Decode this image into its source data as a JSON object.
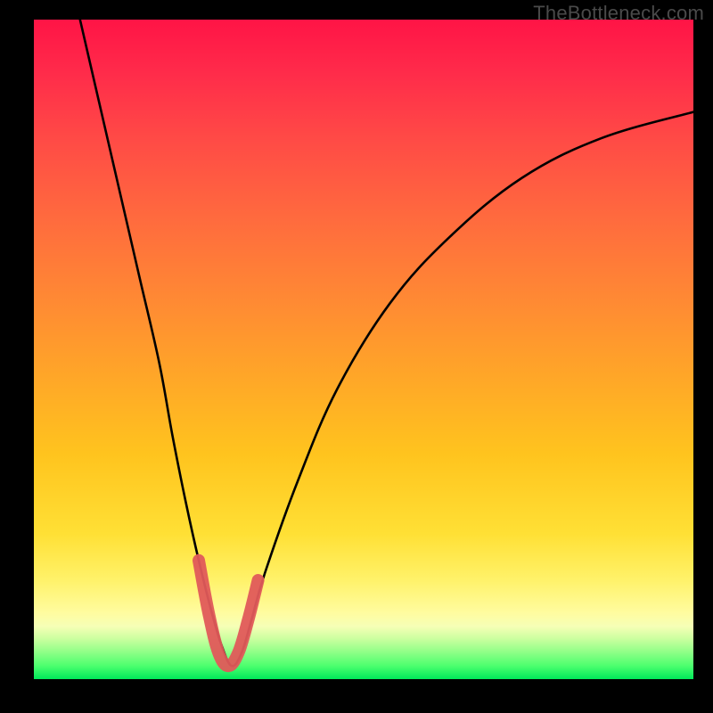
{
  "watermark": "TheBottleneck.com",
  "chart_data": {
    "type": "line",
    "title": "",
    "xlabel": "",
    "ylabel": "",
    "xlim": [
      0,
      100
    ],
    "ylim": [
      0,
      100
    ],
    "grid": false,
    "legend": false,
    "series": [
      {
        "name": "bottleneck-curve",
        "x": [
          7,
          10,
          13,
          16,
          19,
          21,
          23,
          25,
          27,
          28.5,
          30,
          31.5,
          33,
          35,
          40,
          46,
          54,
          63,
          74,
          86,
          100
        ],
        "values": [
          100,
          87,
          74,
          61,
          48,
          37,
          27,
          18,
          10,
          5,
          2,
          4,
          9,
          16,
          30,
          44,
          57,
          67,
          76,
          82,
          86
        ]
      }
    ],
    "highlight": {
      "x": [
        25,
        26.5,
        28,
        29.5,
        31,
        32.5,
        34
      ],
      "values": [
        18,
        10,
        4,
        2,
        4,
        9,
        15
      ]
    },
    "gradient_colors": {
      "top": "#ff1446",
      "mid": "#ffd028",
      "bottom": "#00e85a"
    }
  }
}
